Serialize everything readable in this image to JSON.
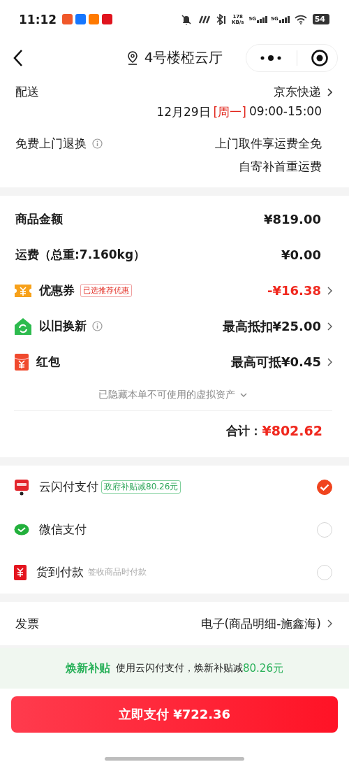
{
  "status_bar": {
    "time": "11:12",
    "speed": "178",
    "speed_unit": "KB/s",
    "signals": [
      "5G",
      "5G"
    ],
    "battery": "54"
  },
  "nav": {
    "title": "4号楼椏云厅"
  },
  "delivery": {
    "label": "配送",
    "carrier": "京东快递",
    "date": "12月29日",
    "weekday": "[周一]",
    "time_range": "09:00-15:00"
  },
  "returns": {
    "label": "免费上门退换",
    "lines": [
      "上门取件享运费全免",
      "自寄补首重运费"
    ]
  },
  "amounts": [
    {
      "kind": "plain",
      "label": "商品金额",
      "value": "¥819.00",
      "discount": false,
      "chevron": false
    },
    {
      "kind": "plain",
      "label": "运费（总重:7.160kg）",
      "value": "¥0.00",
      "discount": false,
      "chevron": false
    },
    {
      "kind": "coupon",
      "label": "优惠券",
      "tag": "已选推荐优惠",
      "value": "-¥16.38",
      "discount": true,
      "chevron": true
    },
    {
      "kind": "tradein",
      "label": "以旧换新",
      "info": true,
      "value": "最高抵扣¥25.00",
      "discount": false,
      "chevron": true
    },
    {
      "kind": "redpacket",
      "label": "红包",
      "value": "最高可抵¥0.45",
      "discount": false,
      "chevron": true
    }
  ],
  "hidden_note": "已隐藏本单不可使用的虚拟资产",
  "total": {
    "label": "合计：",
    "amount": "¥802.62"
  },
  "payments": [
    {
      "kind": "unionpay",
      "name": "云闪付支付",
      "tag": "政府补贴减80.26元",
      "selected": true
    },
    {
      "kind": "wechat",
      "name": "微信支付",
      "selected": false
    },
    {
      "kind": "cod",
      "name": "货到付款",
      "note": "签收商品时付款",
      "selected": false
    }
  ],
  "invoice": {
    "label": "发票",
    "value": "电子(商品明细-施鑫海)"
  },
  "banner": {
    "title": "焕新补贴",
    "text": "使用云闪付支付，焕新补贴减",
    "amount": "80.26元"
  },
  "pay_button": "立即支付 ¥722.36"
}
